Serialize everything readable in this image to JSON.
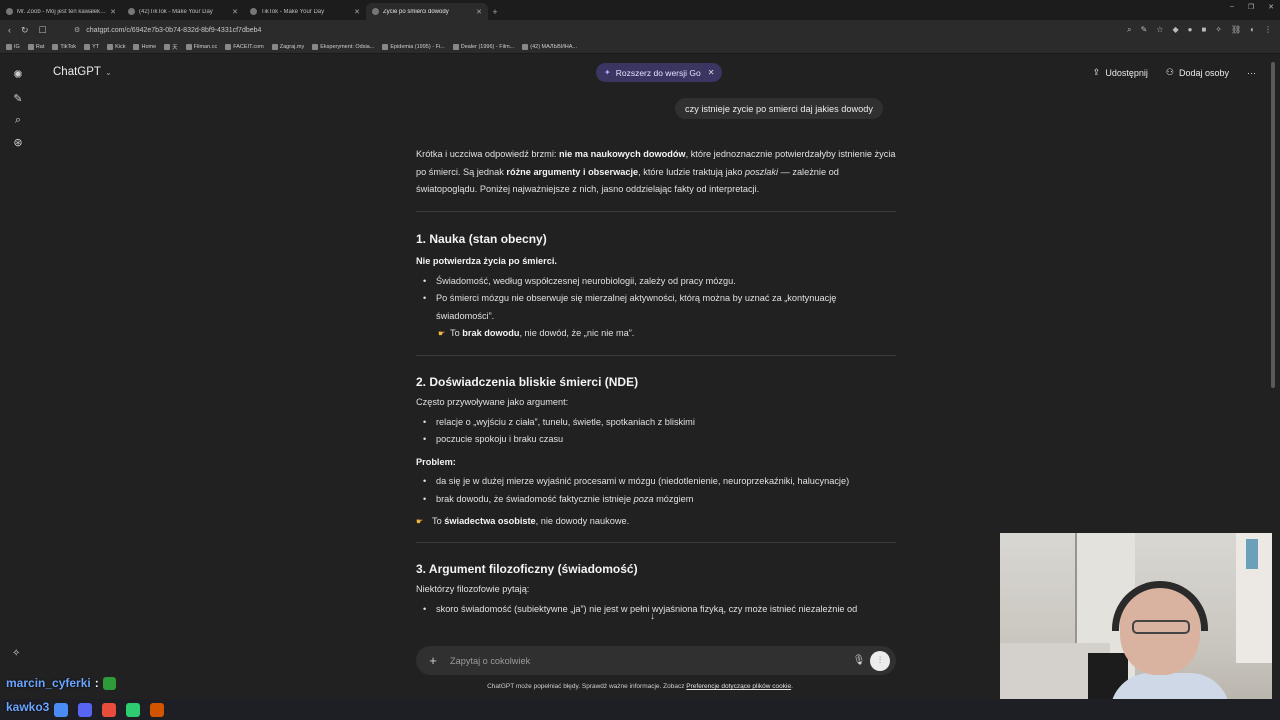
{
  "browser": {
    "tabs": [
      {
        "title": "Mr. Zoob - Mój jest ten kawałek podł",
        "active": false
      },
      {
        "title": "(42)TikTok - Make Your Day",
        "active": false
      },
      {
        "title": "TikTok - Make Your Day",
        "active": false
      },
      {
        "title": "Życie po śmierci dowody",
        "active": true
      }
    ],
    "new_tab": "+",
    "window_controls": [
      "–",
      "❐",
      "✕"
    ],
    "url": "chatgpt.com/c/6942e7b3-0b74-832d-8bf9-4331cf7dbeb4",
    "bookmarks": [
      "IG",
      "Rat",
      "TikTok",
      "YT",
      "Kick",
      "Home",
      "天",
      "Filman.cc",
      "FACEIT.com",
      "Zagraj.my",
      "Eksperyment: Odsia...",
      "Epidemia (1995) - Fi...",
      "Dealer (1996) - Film...",
      "(42) МАЛЬВИНА..."
    ]
  },
  "app": {
    "brand": "ChatGPT",
    "upgrade_label": "Rozszerz do wersji Go",
    "share_label": "Udostępnij",
    "add_people_label": "Dodaj osoby",
    "more_label": "···"
  },
  "conversation": {
    "user_message": "czy istnieje zycie po smierci daj jakies dowody",
    "intro": {
      "t1": "Krótka i uczciwa odpowiedź brzmi: ",
      "b1": "nie ma naukowych dowodów",
      "t2": ", które jednoznacznie potwierdzałyby istnienie życia po śmierci. Są jednak ",
      "b2": "różne argumenty i obserwacje",
      "t3": ", które ludzie traktują jako ",
      "i1": "poszlaki",
      "t4": " — zależnie od światopoglądu. Poniżej najważniejsze z nich, jasno oddzielając fakty od interpretacji."
    },
    "s1": {
      "heading": "1. Nauka (stan obecny)",
      "lead": "Nie potwierdza życia po śmierci.",
      "bullets": [
        "Świadomość, według współczesnej neurobiologii, zależy od pracy mózgu.",
        "Po śmierci mózgu nie obserwuje się mierzalnej aktywności, którą można by uznać za „kontynuację świadomości”."
      ],
      "note_t1": "To ",
      "note_b": "brak dowodu",
      "note_t2": ", nie dowód, że „nic nie ma”."
    },
    "s2": {
      "heading": "2. Doświadczenia bliskie śmierci (NDE)",
      "lead": "Często przywoływane jako argument:",
      "bullets": [
        "relacje o „wyjściu z ciała”, tunelu, świetle, spotkaniach z bliskimi",
        "poczucie spokoju i braku czasu"
      ],
      "problem_label": "Problem:",
      "problem_bullet1": "da się je w dużej mierze wyjaśnić procesami w mózgu (niedotlenienie, neuroprzekaźniki, halucynacje)",
      "problem_bullet2_t1": "brak dowodu, że świadomość faktycznie istnieje ",
      "problem_bullet2_i": "poza",
      "problem_bullet2_t2": " mózgiem",
      "note_t1": "To ",
      "note_b": "świadectwa osobiste",
      "note_t2": ", nie dowody naukowe."
    },
    "s3": {
      "heading": "3. Argument filozoficzny (świadomość)",
      "lead": "Niektórzy filozofowie pytają:",
      "bullet1": "skoro świadomość (subiektywne „ja”) nie jest w pełni wyjaśniona fizyką, czy może istnieć niezależnie od"
    },
    "scroll_down": "↓"
  },
  "composer": {
    "placeholder": "Zapytaj o cokolwiek",
    "disclaimer_text": "ChatGPT może popełniać błędy. Sprawdź ważne informacje. Zobacz ",
    "disclaimer_link": "Preferencje dotyczące plików cookie",
    "disclaimer_end": "."
  },
  "stream_overlay": {
    "chat_user": "marcin_cyferki",
    "chat_sep": ":",
    "chat_user2": "kawko3"
  },
  "colors": {
    "background": "#212121",
    "upgrade_pill": "#3b3562",
    "accent_text": "#ececec"
  }
}
